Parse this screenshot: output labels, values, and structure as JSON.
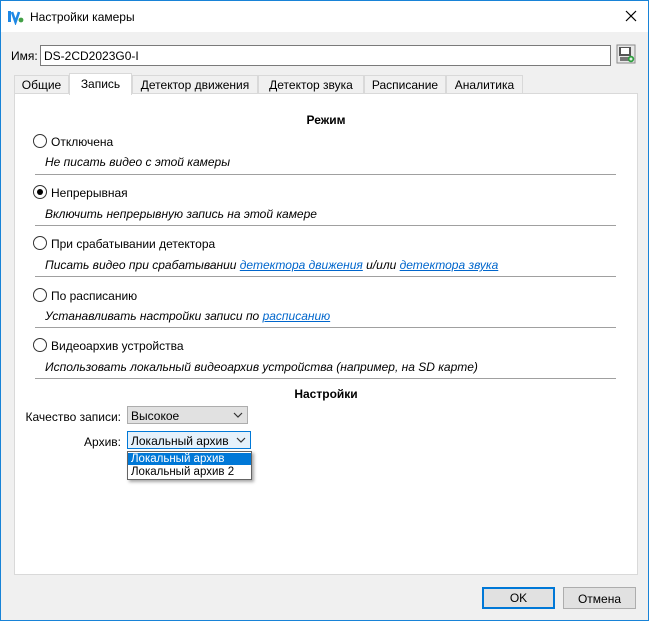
{
  "window": {
    "title": "Настройки камеры"
  },
  "name_field": {
    "label": "Имя:",
    "value": "DS-2CD2023G0-I"
  },
  "tabs": [
    {
      "label": "Общие",
      "active": false
    },
    {
      "label": "Запись",
      "active": true
    },
    {
      "label": "Детектор движения",
      "active": false
    },
    {
      "label": "Детектор звука",
      "active": false
    },
    {
      "label": "Расписание",
      "active": false
    },
    {
      "label": "Аналитика",
      "active": false
    }
  ],
  "mode": {
    "title": "Режим",
    "options": [
      {
        "label": "Отключена",
        "desc": "Не писать видео с этой камеры",
        "checked": false
      },
      {
        "label": "Непрерывная",
        "desc": "Включить непрерывную запись на этой камере",
        "checked": true
      },
      {
        "label": "При срабатывании детектора",
        "desc_prefix": "Писать видео при срабатывании ",
        "link1": "детектора движения",
        "desc_middle": " и/или ",
        "link2": "детектора звука",
        "checked": false
      },
      {
        "label": "По расписанию",
        "desc_prefix": "Устанавливать настройки записи по ",
        "link1": "расписанию",
        "checked": false
      },
      {
        "label": "Видеоархив устройства",
        "desc": "Использовать локальный видеоархив устройства (например, на SD карте)",
        "checked": false
      }
    ]
  },
  "settings": {
    "title": "Настройки",
    "quality_label": "Качество записи:",
    "quality_value": "Высокое",
    "archive_label": "Архив:",
    "archive_value": "Локальный архив",
    "archive_options": [
      "Локальный архив",
      "Локальный архив 2"
    ]
  },
  "buttons": {
    "ok": "OK",
    "cancel": "Отмена"
  },
  "colors": {
    "accent": "#0078d7",
    "link": "#0066cc",
    "logo": "#1e88e5"
  },
  "icons": {
    "app": "app-logo-icon",
    "close": "close-icon",
    "save": "save-icon",
    "chevron": "chevron-down-icon"
  }
}
